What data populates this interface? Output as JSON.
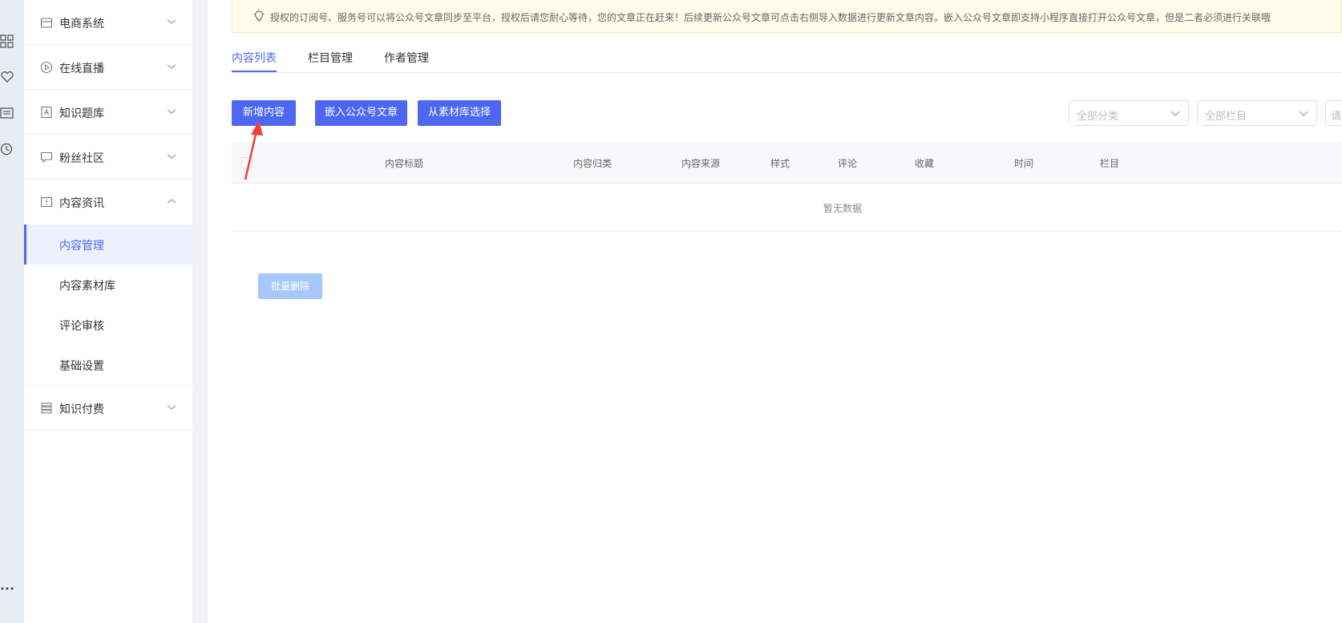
{
  "sidebar": {
    "groups": [
      {
        "label": "电商系统",
        "icon": "shop-icon"
      },
      {
        "label": "在线直播",
        "icon": "play-icon"
      },
      {
        "label": "知识题库",
        "icon": "quiz-icon"
      },
      {
        "label": "粉丝社区",
        "icon": "chat-icon"
      },
      {
        "label": "内容资讯",
        "icon": "info-icon"
      },
      {
        "label": "知识付费",
        "icon": "stack-icon"
      }
    ],
    "sub_items": [
      {
        "label": "内容管理"
      },
      {
        "label": "内容素材库"
      },
      {
        "label": "评论审核"
      },
      {
        "label": "基础设置"
      }
    ]
  },
  "notice": {
    "text": "授权的订阅号、服务号可以将公众号文章同步至平台，授权后请您耐心等待，您的文章正在赶来！后续更新公众号文章可点击右侧导入数据进行更新文章内容。嵌入公众号文章即支持小程序直接打开公众号文章，但是二者必须进行关联哦"
  },
  "tabs": [
    {
      "label": "内容列表"
    },
    {
      "label": "栏目管理"
    },
    {
      "label": "作者管理"
    }
  ],
  "toolbar": {
    "add_label": "新增内容",
    "embed_label": "嵌入公众号文章",
    "library_label": "从素材库选择"
  },
  "filters": {
    "category_placeholder": "全部分类",
    "column_placeholder": "全部栏目",
    "search_placeholder": "请"
  },
  "table": {
    "columns": [
      "内容标题",
      "内容归类",
      "内容来源",
      "样式",
      "评论",
      "收藏",
      "时间",
      "栏目"
    ],
    "empty_text": "暂无数据"
  },
  "batch_delete_label": "批量删除",
  "colors": {
    "accent": "#4e67f2",
    "annotation_arrow": "#f23d3d",
    "disabled_button": "#a8c7fa"
  }
}
